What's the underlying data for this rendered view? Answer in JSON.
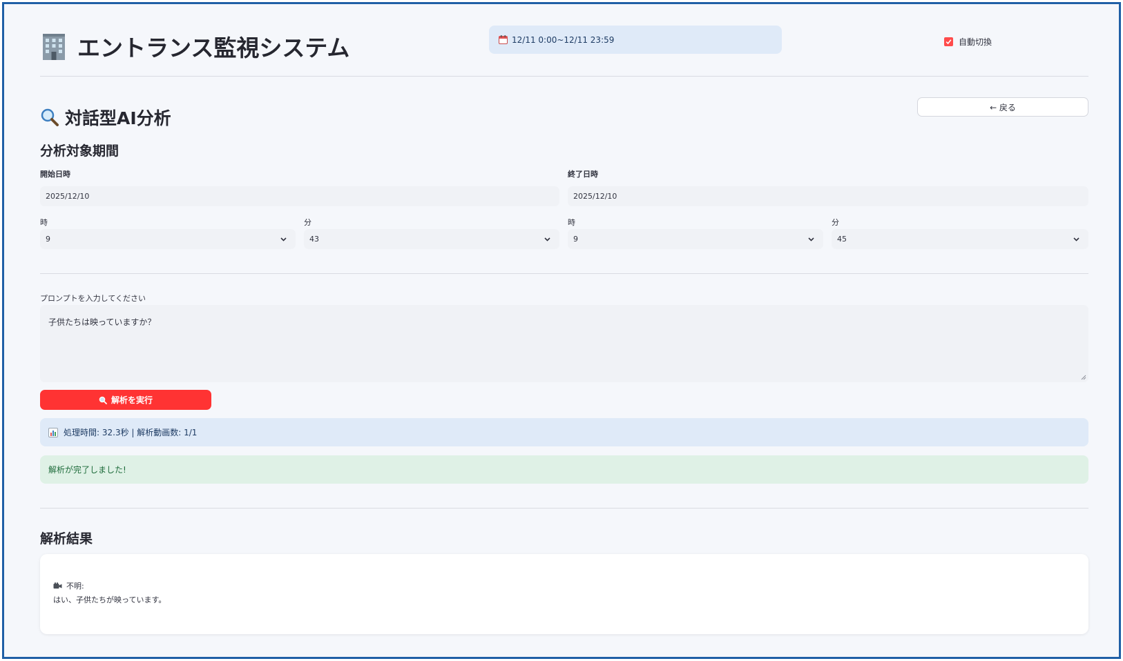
{
  "header": {
    "title": "エントランス監視システム",
    "date_range": "12/11 0:00~12/11 23:59",
    "auto_switch_label": "自動切換",
    "auto_switch_checked": true
  },
  "page": {
    "heading": "対話型AI分析",
    "back_label": "← 戻る"
  },
  "period": {
    "title": "分析対象期間",
    "start": {
      "label": "開始日時",
      "date": "2025/12/10",
      "hour_label": "時",
      "hour_value": "9",
      "minute_label": "分",
      "minute_value": "43"
    },
    "end": {
      "label": "終了日時",
      "date": "2025/12/10",
      "hour_label": "時",
      "hour_value": "9",
      "minute_label": "分",
      "minute_value": "45"
    }
  },
  "prompt": {
    "label": "プロンプトを入力してください",
    "value": "子供たちは映っていますか？"
  },
  "run_button_label": "解析を実行",
  "status": {
    "info": "処理時間: 32.3秒 | 解析動画数: 1/1",
    "success": "解析が完了しました!"
  },
  "results": {
    "title": "解析結果",
    "camera_label": "不明:",
    "answer": "はい、子供たちが映っています。"
  },
  "colors": {
    "accent": "#ff4b4b",
    "button": "#ff3333",
    "info_bg": "#dfeaf8",
    "success_bg": "#dff1e6",
    "border": "#1f5fa6"
  }
}
